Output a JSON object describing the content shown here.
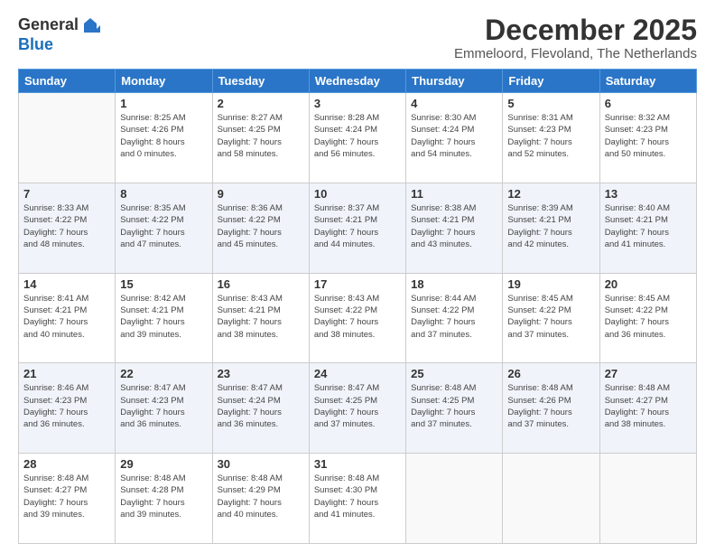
{
  "logo": {
    "general": "General",
    "blue": "Blue"
  },
  "title": "December 2025",
  "location": "Emmeloord, Flevoland, The Netherlands",
  "weekdays": [
    "Sunday",
    "Monday",
    "Tuesday",
    "Wednesday",
    "Thursday",
    "Friday",
    "Saturday"
  ],
  "weeks": [
    [
      {
        "day": "",
        "info": ""
      },
      {
        "day": "1",
        "info": "Sunrise: 8:25 AM\nSunset: 4:26 PM\nDaylight: 8 hours\nand 0 minutes."
      },
      {
        "day": "2",
        "info": "Sunrise: 8:27 AM\nSunset: 4:25 PM\nDaylight: 7 hours\nand 58 minutes."
      },
      {
        "day": "3",
        "info": "Sunrise: 8:28 AM\nSunset: 4:24 PM\nDaylight: 7 hours\nand 56 minutes."
      },
      {
        "day": "4",
        "info": "Sunrise: 8:30 AM\nSunset: 4:24 PM\nDaylight: 7 hours\nand 54 minutes."
      },
      {
        "day": "5",
        "info": "Sunrise: 8:31 AM\nSunset: 4:23 PM\nDaylight: 7 hours\nand 52 minutes."
      },
      {
        "day": "6",
        "info": "Sunrise: 8:32 AM\nSunset: 4:23 PM\nDaylight: 7 hours\nand 50 minutes."
      }
    ],
    [
      {
        "day": "7",
        "info": "Sunrise: 8:33 AM\nSunset: 4:22 PM\nDaylight: 7 hours\nand 48 minutes."
      },
      {
        "day": "8",
        "info": "Sunrise: 8:35 AM\nSunset: 4:22 PM\nDaylight: 7 hours\nand 47 minutes."
      },
      {
        "day": "9",
        "info": "Sunrise: 8:36 AM\nSunset: 4:22 PM\nDaylight: 7 hours\nand 45 minutes."
      },
      {
        "day": "10",
        "info": "Sunrise: 8:37 AM\nSunset: 4:21 PM\nDaylight: 7 hours\nand 44 minutes."
      },
      {
        "day": "11",
        "info": "Sunrise: 8:38 AM\nSunset: 4:21 PM\nDaylight: 7 hours\nand 43 minutes."
      },
      {
        "day": "12",
        "info": "Sunrise: 8:39 AM\nSunset: 4:21 PM\nDaylight: 7 hours\nand 42 minutes."
      },
      {
        "day": "13",
        "info": "Sunrise: 8:40 AM\nSunset: 4:21 PM\nDaylight: 7 hours\nand 41 minutes."
      }
    ],
    [
      {
        "day": "14",
        "info": "Sunrise: 8:41 AM\nSunset: 4:21 PM\nDaylight: 7 hours\nand 40 minutes."
      },
      {
        "day": "15",
        "info": "Sunrise: 8:42 AM\nSunset: 4:21 PM\nDaylight: 7 hours\nand 39 minutes."
      },
      {
        "day": "16",
        "info": "Sunrise: 8:43 AM\nSunset: 4:21 PM\nDaylight: 7 hours\nand 38 minutes."
      },
      {
        "day": "17",
        "info": "Sunrise: 8:43 AM\nSunset: 4:22 PM\nDaylight: 7 hours\nand 38 minutes."
      },
      {
        "day": "18",
        "info": "Sunrise: 8:44 AM\nSunset: 4:22 PM\nDaylight: 7 hours\nand 37 minutes."
      },
      {
        "day": "19",
        "info": "Sunrise: 8:45 AM\nSunset: 4:22 PM\nDaylight: 7 hours\nand 37 minutes."
      },
      {
        "day": "20",
        "info": "Sunrise: 8:45 AM\nSunset: 4:22 PM\nDaylight: 7 hours\nand 36 minutes."
      }
    ],
    [
      {
        "day": "21",
        "info": "Sunrise: 8:46 AM\nSunset: 4:23 PM\nDaylight: 7 hours\nand 36 minutes."
      },
      {
        "day": "22",
        "info": "Sunrise: 8:47 AM\nSunset: 4:23 PM\nDaylight: 7 hours\nand 36 minutes."
      },
      {
        "day": "23",
        "info": "Sunrise: 8:47 AM\nSunset: 4:24 PM\nDaylight: 7 hours\nand 36 minutes."
      },
      {
        "day": "24",
        "info": "Sunrise: 8:47 AM\nSunset: 4:25 PM\nDaylight: 7 hours\nand 37 minutes."
      },
      {
        "day": "25",
        "info": "Sunrise: 8:48 AM\nSunset: 4:25 PM\nDaylight: 7 hours\nand 37 minutes."
      },
      {
        "day": "26",
        "info": "Sunrise: 8:48 AM\nSunset: 4:26 PM\nDaylight: 7 hours\nand 37 minutes."
      },
      {
        "day": "27",
        "info": "Sunrise: 8:48 AM\nSunset: 4:27 PM\nDaylight: 7 hours\nand 38 minutes."
      }
    ],
    [
      {
        "day": "28",
        "info": "Sunrise: 8:48 AM\nSunset: 4:27 PM\nDaylight: 7 hours\nand 39 minutes."
      },
      {
        "day": "29",
        "info": "Sunrise: 8:48 AM\nSunset: 4:28 PM\nDaylight: 7 hours\nand 39 minutes."
      },
      {
        "day": "30",
        "info": "Sunrise: 8:48 AM\nSunset: 4:29 PM\nDaylight: 7 hours\nand 40 minutes."
      },
      {
        "day": "31",
        "info": "Sunrise: 8:48 AM\nSunset: 4:30 PM\nDaylight: 7 hours\nand 41 minutes."
      },
      {
        "day": "",
        "info": ""
      },
      {
        "day": "",
        "info": ""
      },
      {
        "day": "",
        "info": ""
      }
    ]
  ]
}
